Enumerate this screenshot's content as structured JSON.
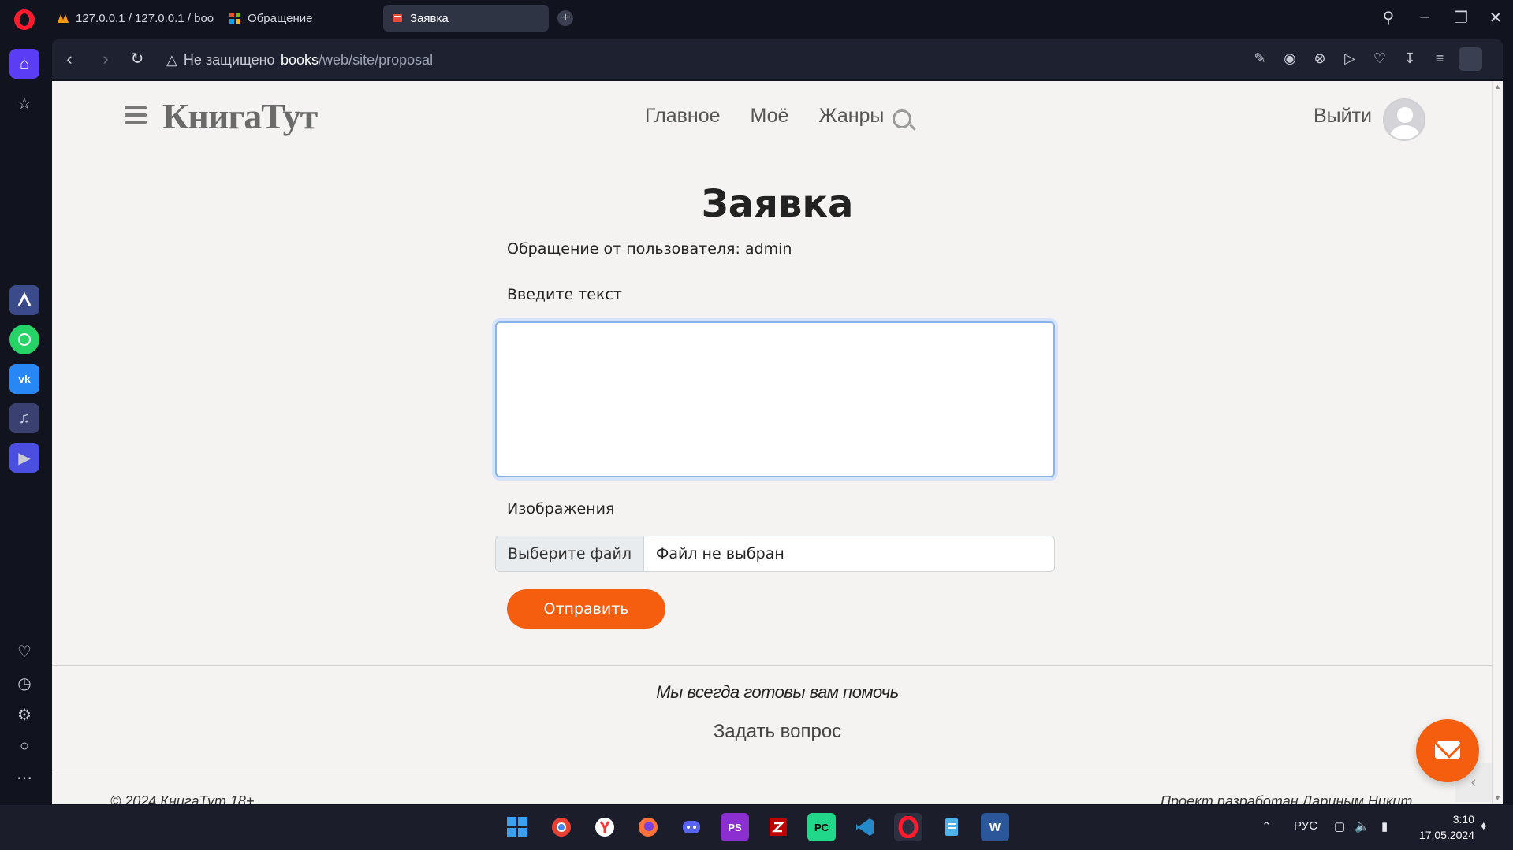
{
  "browser": {
    "tabs": [
      {
        "label": "127.0.0.1 / 127.0.0.1 / boo",
        "active": false
      },
      {
        "label": "Обращение",
        "active": false
      },
      {
        "label": "Заявка",
        "active": true
      }
    ],
    "new_tab": "+",
    "security_label": "Не защищено",
    "url_host": "books",
    "url_path": "/web/site/proposal"
  },
  "site": {
    "logo": "КнигаТут",
    "nav": [
      "Главное",
      "Моё",
      "Жанры"
    ],
    "logout": "Выйти"
  },
  "form": {
    "title": "Заявка",
    "from_line": "Обращение от пользователя: admin",
    "text_label": "Введите текст",
    "text_value": "",
    "images_label": "Изображения",
    "file_button": "Выберите файл",
    "file_status": "Файл не выбран",
    "submit": "Отправить"
  },
  "footer": {
    "tagline": "Мы всегда готовы вам помочь",
    "ask": "Задать вопрос",
    "copyright": "© 2024 КнигаТут 18+",
    "credit": "Проект разработан Дариным Никит"
  },
  "taskbar": {
    "lang": "РУС",
    "time": "3:10",
    "date": "17.05.2024"
  },
  "colors": {
    "accent": "#f55d0f",
    "browser_bg": "#11141f",
    "page_bg": "#f4f3f1"
  }
}
